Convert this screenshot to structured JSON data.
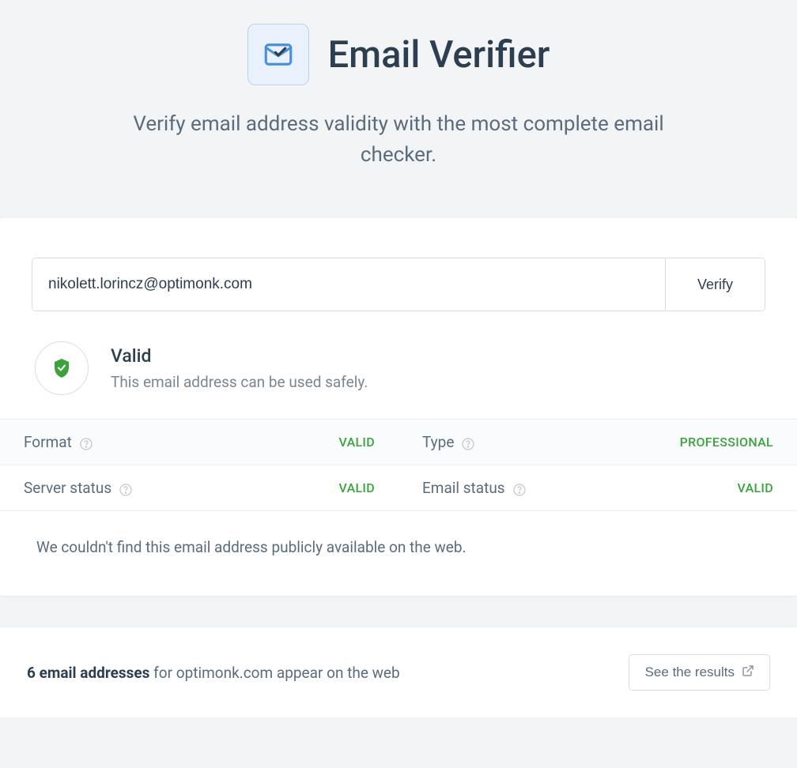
{
  "header": {
    "title": "Email Verifier",
    "subtitle": "Verify email address validity with the most complete email checker."
  },
  "search": {
    "input_value": "nikolett.lorincz@optimonk.com",
    "verify_label": "Verify"
  },
  "status": {
    "title": "Valid",
    "description": "This email address can be used safely."
  },
  "details": {
    "format": {
      "label": "Format",
      "value": "VALID"
    },
    "type": {
      "label": "Type",
      "value": "PROFESSIONAL"
    },
    "server_status": {
      "label": "Server status",
      "value": "VALID"
    },
    "email_status": {
      "label": "Email status",
      "value": "VALID"
    }
  },
  "no_results_message": "We couldn't find this email address publicly available on the web.",
  "footer": {
    "count_bold": "6 email addresses",
    "count_rest": " for optimonk.com appear on the web",
    "button_label": "See the results"
  }
}
